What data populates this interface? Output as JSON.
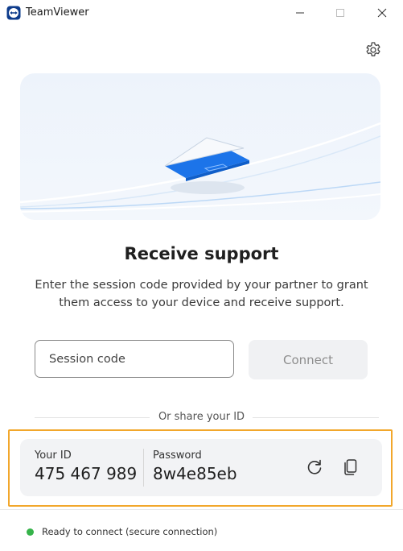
{
  "window": {
    "title": "TeamViewer",
    "controls": [
      "minimize",
      "maximize",
      "close"
    ]
  },
  "header": {
    "settings_icon": "gear-icon"
  },
  "main": {
    "heading": "Receive support",
    "description": "Enter the session code provided by your partner to grant them access to your device and receive support.",
    "session_input": {
      "value": "",
      "placeholder": "Session code"
    },
    "connect_label": "Connect"
  },
  "share": {
    "divider_label": "Or share your ID",
    "id_label": "Your ID",
    "id_value": "475 467 989",
    "password_label": "Password",
    "password_value": "8w4e85eb",
    "refresh_icon": "refresh-icon",
    "copy_icon": "copy-icon"
  },
  "status": {
    "text": "Ready to connect (secure connection)",
    "color": "#36b34a"
  },
  "colors": {
    "accent": "#1c74e9",
    "highlight_border": "#f2a72b",
    "connect_disabled_bg": "#f0f1f3"
  }
}
